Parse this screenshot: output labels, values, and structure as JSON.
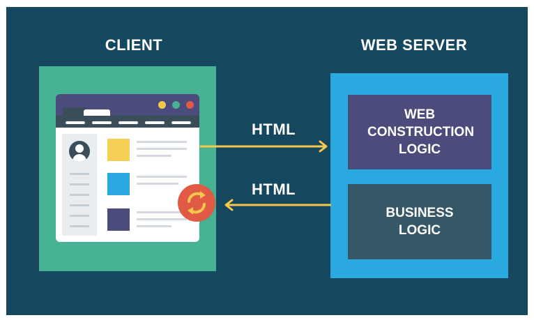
{
  "client": {
    "heading": "CLIENT"
  },
  "server": {
    "heading": "WEB SERVER",
    "boxes": [
      {
        "label": "WEB CONSTRUCTION LOGIC"
      },
      {
        "label": "BUSINESS LOGIC"
      }
    ]
  },
  "arrows": [
    {
      "label": "HTML",
      "direction": "client-to-server"
    },
    {
      "label": "HTML",
      "direction": "server-to-client"
    }
  ],
  "icons": [
    "browser-window-icon",
    "user-avatar-icon",
    "refresh-icon"
  ],
  "colors": {
    "background": "#15485f",
    "client_panel": "#47b194",
    "server_panel": "#2aa9e1",
    "web_logic_box": "#4b4b7c",
    "business_logic_box": "#365766",
    "arrow": "#f5c74a",
    "refresh_icon": "#e05a45"
  }
}
